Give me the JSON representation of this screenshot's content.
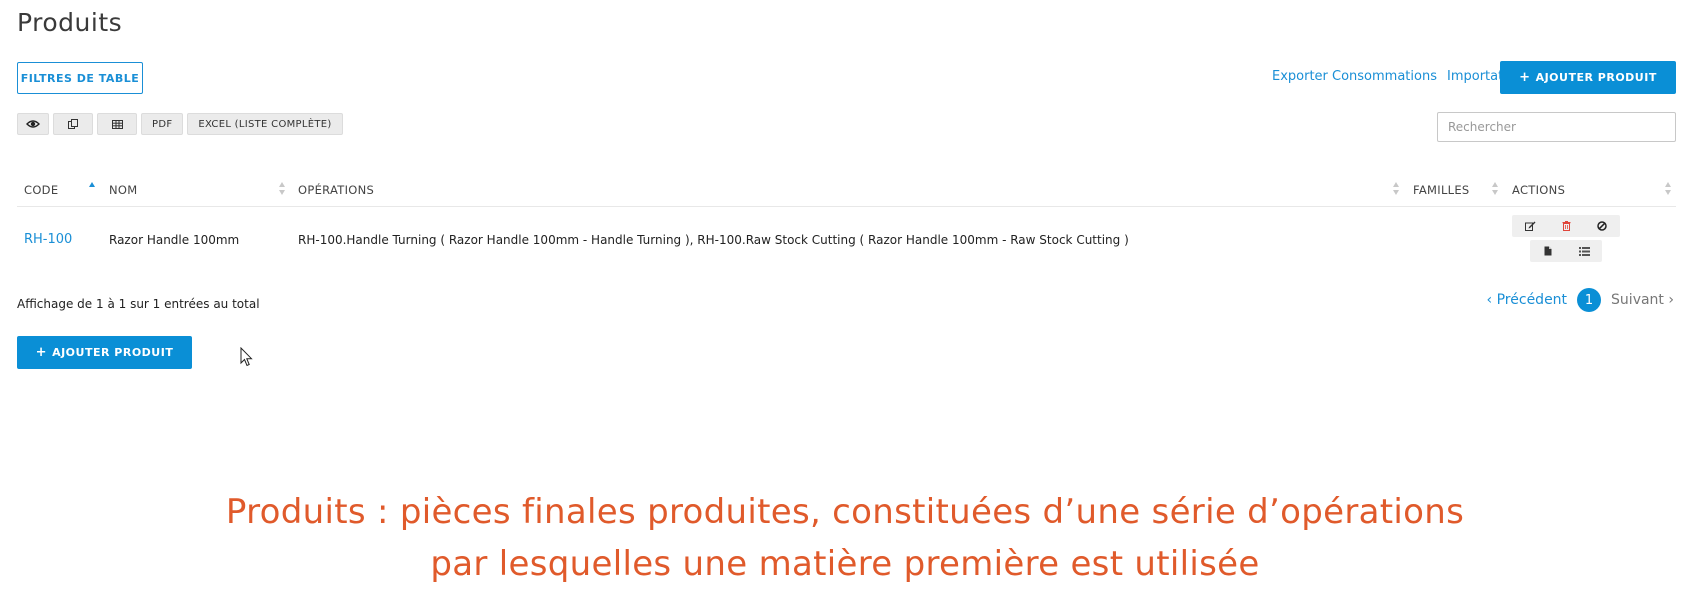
{
  "page_title": "Produits",
  "filters_button": "FILTRES DE TABLE",
  "top_links": {
    "export": "Exporter Consommations",
    "import": "Importation"
  },
  "add_button": "AJOUTER PRODUIT",
  "toolbar": {
    "pdf": "PDF",
    "excel": "EXCEL (LISTE COMPLÈTE)",
    "icons": [
      "eye-icon",
      "copy-icon",
      "grid-icon"
    ]
  },
  "search": {
    "placeholder": "Rechercher",
    "value": ""
  },
  "table": {
    "headers": {
      "code": "CODE",
      "nom": "NOM",
      "operations": "OPÉRATIONS",
      "familles": "FAMILLES",
      "actions": "ACTIONS"
    },
    "rows": [
      {
        "code": "RH-100",
        "nom": "Razor Handle 100mm",
        "operations": "RH-100.Handle Turning ( Razor Handle 100mm - Handle Turning ), RH-100.Raw Stock Cutting ( Razor Handle 100mm - Raw Stock Cutting )",
        "familles": "",
        "actions": [
          "edit-icon",
          "delete-icon",
          "disable-icon",
          "document-icon",
          "list-icon"
        ]
      }
    ]
  },
  "info_text": "Affichage de 1 à 1 sur 1 entrées au total",
  "pagination": {
    "prev": "Précédent",
    "current": "1",
    "next": "Suivant"
  },
  "caption": {
    "line1": "Produits : pièces finales produites, constituées d’une série d’opérations",
    "line2": "par lesquelles une matière première est utilisée"
  },
  "colors": {
    "accent": "#0a8fd6",
    "caption": "#e05a2b",
    "delete": "#e0453a"
  }
}
